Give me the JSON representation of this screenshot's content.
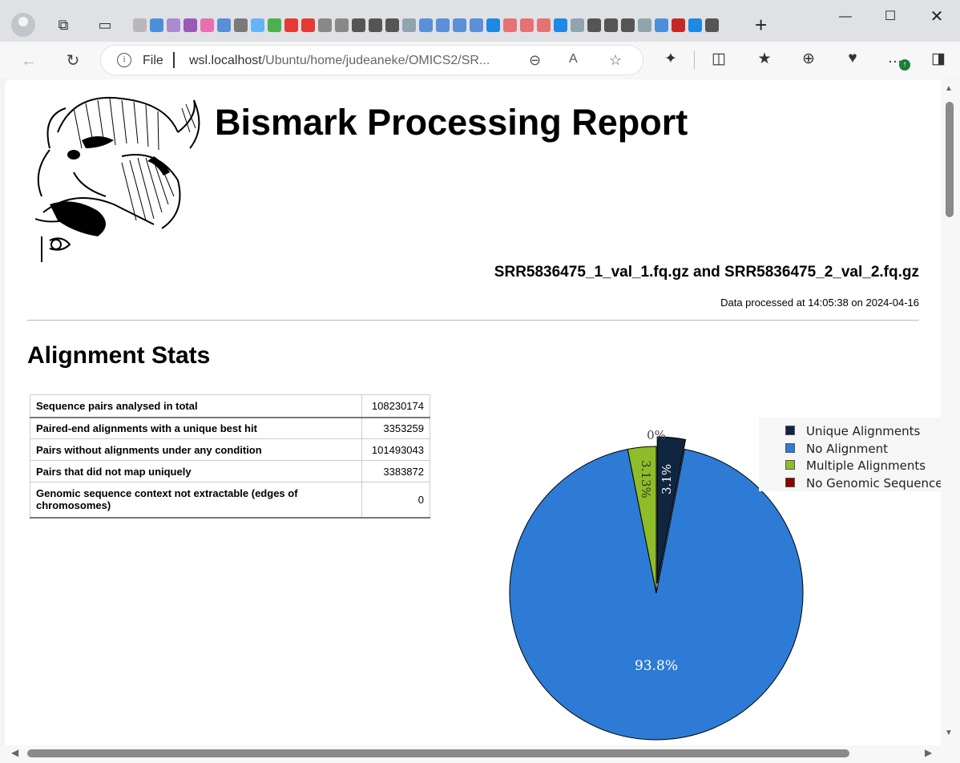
{
  "browser": {
    "tab_favicon_colors": [
      "#b8b8b8",
      "#4a90d9",
      "#a88bd0",
      "#9b59b6",
      "#e96fb0",
      "#5a8fd8",
      "#7a7a7a",
      "#64b5f6",
      "#4caf50",
      "#e53935",
      "#e53935",
      "#888888",
      "#888888",
      "#555555",
      "#555555",
      "#555555",
      "#90a4ae",
      "#5b8fd8",
      "#5b8fd8",
      "#5b8fd8",
      "#5b8fd8",
      "#1e88e5",
      "#e57373",
      "#e57373",
      "#e57373",
      "#1e88e5",
      "#90a4ae",
      "#555555",
      "#555555",
      "#555555",
      "#90a4ae",
      "#4a90d9",
      "#c62828",
      "#1e88e5",
      "#555555",
      "#555555"
    ],
    "address": {
      "scheme_label": "File",
      "url_host": "wsl.localhost",
      "url_path": "/Ubuntu/home/judeaneke/OMICS2/SR..."
    }
  },
  "report": {
    "title": "Bismark Processing Report",
    "files": "SRR5836475_1_val_1.fq.gz and SRR5836475_2_val_2.fq.gz",
    "processed": "Data processed at 14:05:38 on 2024-04-16",
    "section_title": "Alignment Stats",
    "table": [
      {
        "label": "Sequence pairs analysed in total",
        "value": "108230174"
      },
      {
        "label": "Paired-end alignments with a unique best hit",
        "value": "3353259"
      },
      {
        "label": "Pairs without alignments under any condition",
        "value": "101493043"
      },
      {
        "label": "Pairs that did not map uniquely",
        "value": "3383872"
      },
      {
        "label": "Genomic sequence context not extractable (edges of chromosomes)",
        "value": "0"
      }
    ]
  },
  "chart_data": {
    "type": "pie",
    "labels": [
      "Unique Alignments",
      "No Alignment",
      "Multiple Alignments",
      "No Genomic Sequence"
    ],
    "values": [
      3.1,
      93.8,
      3.13,
      0
    ],
    "slice_labels": [
      "3.1%",
      "93.8%",
      "3.13%",
      "0%"
    ],
    "colors": [
      "#0f2540",
      "#2e7bd6",
      "#8ebd29",
      "#8b0000"
    ],
    "legend_position": "top-right"
  }
}
